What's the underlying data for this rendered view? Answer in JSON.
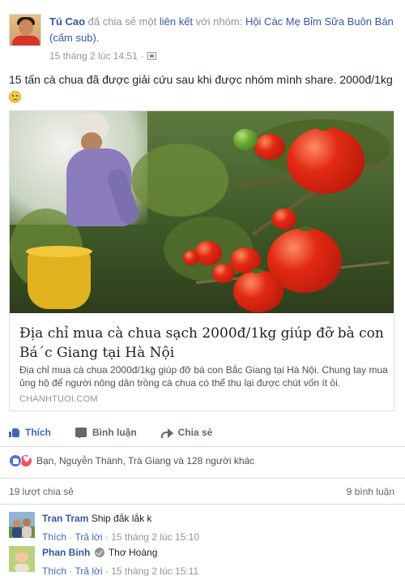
{
  "post": {
    "author": "Tú Cao",
    "action_text": " đã chia sẻ một ",
    "link_word": "liên kết",
    "to_group_text": " với nhóm: ",
    "group_name": "Hội Các Mẹ Bỉm Sữa Buôn Bán (cấm sub).",
    "timestamp": "15 tháng 2 lúc 14:51",
    "dot": "·",
    "text": "15 tấn cà chua đã được giải cứu sau khi được nhóm mình share. 2000đ/1kg",
    "privacy_icon": "group-privacy-icon",
    "emoji_icon": "sad-face-emoji"
  },
  "link": {
    "title": "Địa chỉ mua cà chua sạch 2000đ/1kg giúp đỡ bà con Bá´c Giang tại Hà Nội",
    "description": "Địa chỉ mua cà chua 2000đ/1kg giúp đỡ bà con Bắc Giang tại Hà Nội. Chung tay mua ủng hộ để người nông dân trồng cà chua có thể thu lại được chút vốn ít ỏi.",
    "domain": "CHANHTUOI.COM"
  },
  "actions": {
    "like": "Thích",
    "comment": "Bình luận",
    "share": "Chia sẻ"
  },
  "reactions": {
    "summary": "Bạn, Nguyễn Thành, Trà Giang và 128 người khác"
  },
  "counts": {
    "shares": "19 lượt chia sẻ",
    "comments": "9 bình luận"
  },
  "comments": [
    {
      "name": "Tran Tram",
      "text": " Ship đắk lắk k",
      "like": "Thích",
      "reply": "Trả lời",
      "sep": " · ",
      "time": "15 tháng 2 lúc 15:10"
    },
    {
      "name": "Phan Binh",
      "tag": "Thơ Hoàng",
      "like": "Thích",
      "reply": "Trả lời",
      "sep": " · ",
      "time": "15 tháng 2 lúc 15:11"
    }
  ],
  "colors": {
    "link_blue": "#365899",
    "action_blue": "#4267b2",
    "meta_gray": "#90949c",
    "heart_red": "#f25268"
  }
}
